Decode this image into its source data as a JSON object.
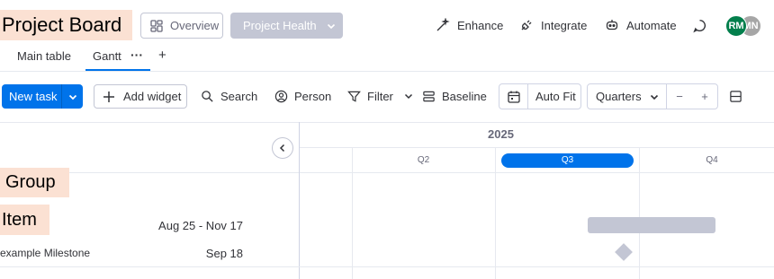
{
  "header": {
    "title": "Project Board",
    "overview_label": "Overview",
    "health_label": "Project Health",
    "actions": [
      "Enhance",
      "Integrate",
      "Automate"
    ],
    "avatars": [
      {
        "initials": "RM",
        "color": "#037f4c"
      },
      {
        "initials": "MN",
        "color": "#a6a6a6"
      }
    ]
  },
  "tabs": {
    "items": [
      "Main table",
      "Gantt"
    ],
    "active": "Gantt",
    "more_glyph": "···",
    "add_glyph": "+"
  },
  "toolbar": {
    "new_task": "New task",
    "add_widget": "Add widget",
    "search": "Search",
    "person": "Person",
    "filter": "Filter",
    "baseline": "Baseline",
    "auto_fit": "Auto Fit",
    "zoom_scale": "Quarters",
    "zoom_out_glyph": "−",
    "zoom_in_glyph": "+"
  },
  "timeline": {
    "year": "2025",
    "quarters": [
      "Q2",
      "Q3",
      "Q4"
    ],
    "current_quarter": "Q3"
  },
  "rows": {
    "group": "Group",
    "item": {
      "name": "Item",
      "dates": "Aug 25 - Nov 17"
    },
    "milestone": {
      "name": "example Milestone",
      "date": "Sep 18"
    }
  },
  "colors": {
    "accent": "#0073ea",
    "highlight": "#fbe1d3",
    "bar": "#c3c6d4"
  }
}
